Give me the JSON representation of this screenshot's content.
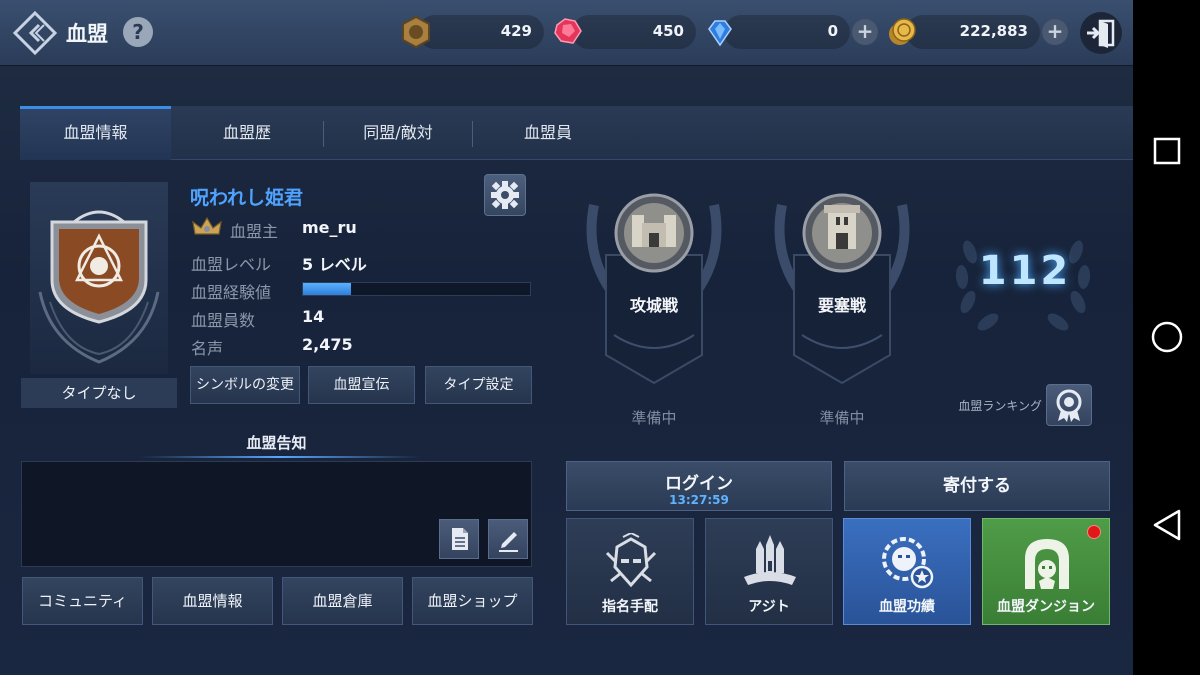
{
  "header": {
    "title": "血盟",
    "help": "?",
    "currencies": [
      {
        "icon": "medal-coin-icon",
        "value": "429"
      },
      {
        "icon": "red-gem-icon",
        "value": "450"
      },
      {
        "icon": "blue-gem-icon",
        "value": "0"
      },
      {
        "icon": "gold-coin-icon",
        "value": "222,883"
      }
    ],
    "plus": "+"
  },
  "tabs": [
    {
      "label": "血盟情報",
      "active": true
    },
    {
      "label": "血盟歴",
      "active": false
    },
    {
      "label": "同盟/敵対",
      "active": false
    },
    {
      "label": "血盟員",
      "active": false
    }
  ],
  "guild": {
    "name": "呪われし姫君",
    "type": "タイプなし",
    "info": [
      {
        "label": "血盟主",
        "value": "me_ru"
      },
      {
        "label": "血盟レベル",
        "value": "5 レベル"
      },
      {
        "label": "血盟経験値",
        "value": ""
      },
      {
        "label": "血盟員数",
        "value": "14"
      },
      {
        "label": "名声",
        "value": "2,475"
      }
    ],
    "xp_fraction": 0.21,
    "buttons": [
      "シンボルの変更",
      "血盟宣伝",
      "タイプ設定"
    ]
  },
  "notice": {
    "title": "血盟告知"
  },
  "bottom_buttons": [
    "コミュニティ",
    "血盟情報",
    "血盟倉庫",
    "血盟ショップ"
  ],
  "wars": [
    {
      "label": "攻城戦",
      "status": "準備中"
    },
    {
      "label": "要塞戦",
      "status": "準備中"
    }
  ],
  "ranking": {
    "value": "112",
    "label": "血盟ランキング"
  },
  "actions": {
    "login": {
      "label": "ログイン",
      "timer": "13:27:59"
    },
    "donate": "寄付する"
  },
  "tiles": [
    {
      "label": "指名手配",
      "icon": "wanted-mask-icon",
      "color": "#2e3d56"
    },
    {
      "label": "アジト",
      "icon": "hideout-castle-icon",
      "color": "#2e3d56"
    },
    {
      "label": "血盟功績",
      "icon": "lion-achievement-icon",
      "color": "#2f5ea8"
    },
    {
      "label": "血盟ダンジョン",
      "icon": "dungeon-gate-icon",
      "color": "#3f8a3a"
    }
  ],
  "colors": {
    "accent": "#3b8ee8",
    "guild_name": "#4fa3ff",
    "notification_dot": "#e01818"
  }
}
